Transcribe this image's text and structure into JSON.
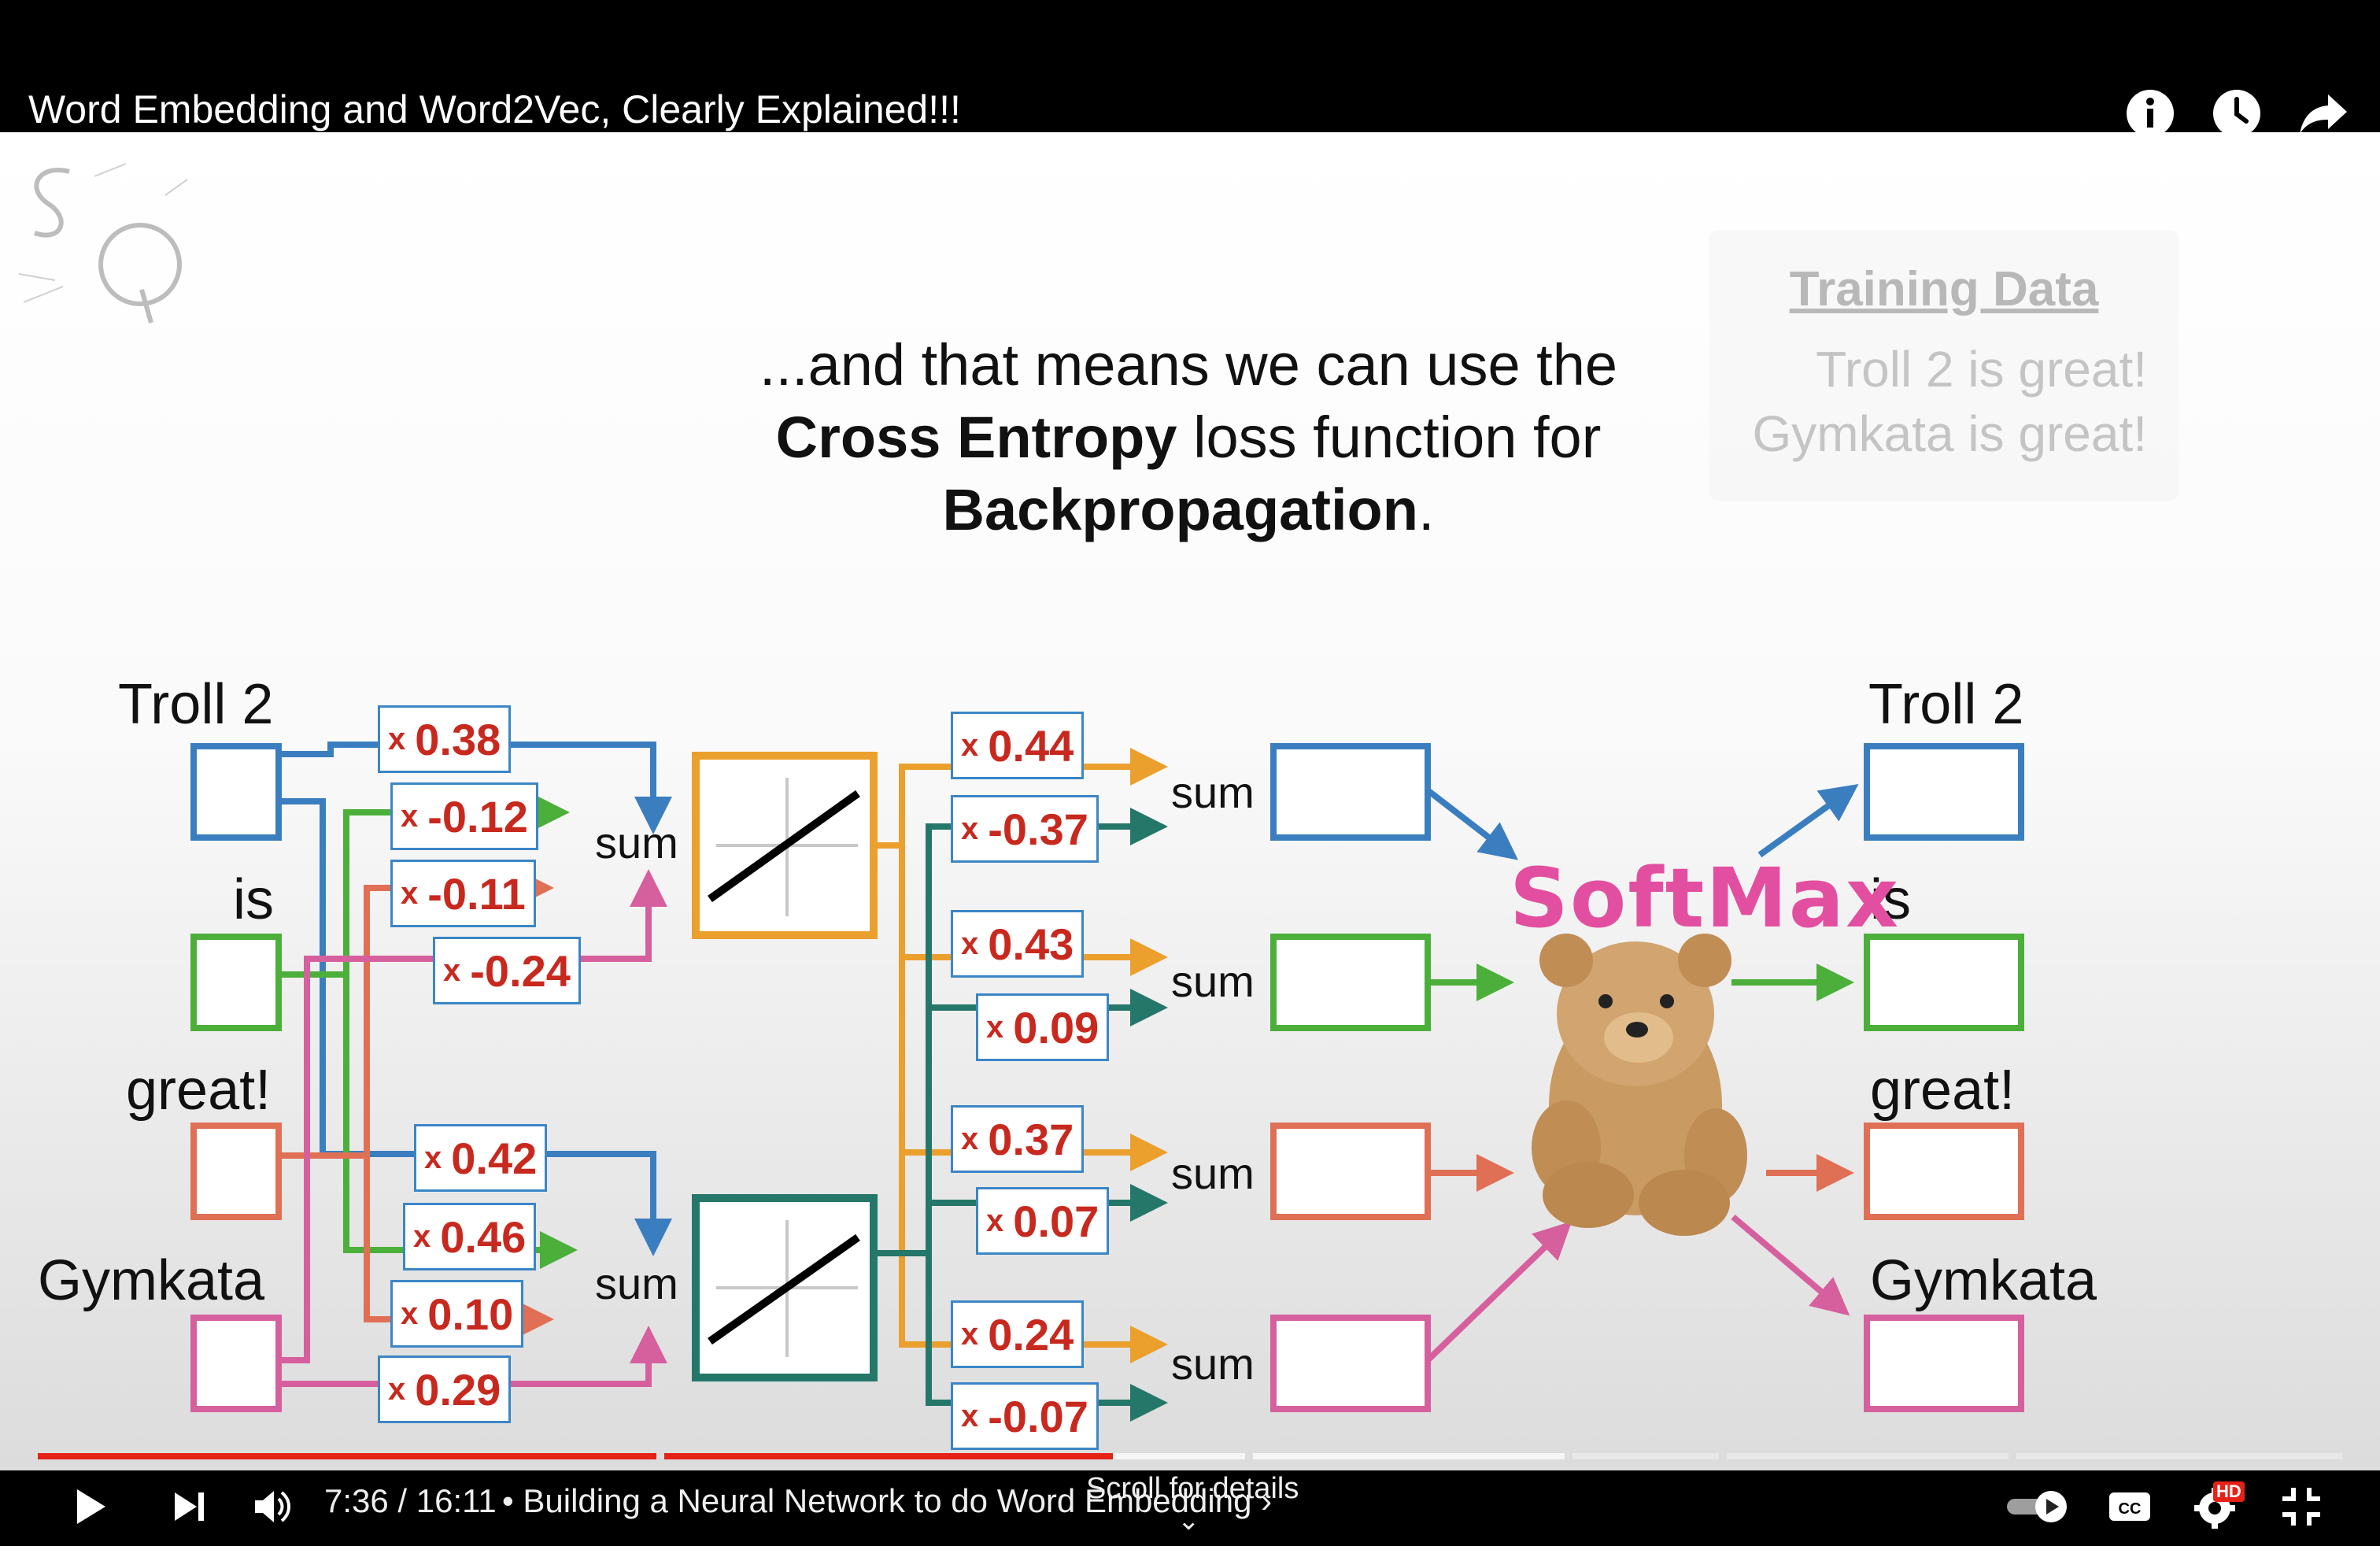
{
  "header": {
    "title": "Word Embedding and Word2Vec, Clearly Explained!!!",
    "icons": [
      "info-icon",
      "clock-icon",
      "share-icon"
    ]
  },
  "slide": {
    "headline": {
      "line1": "...and that means we can use the",
      "bold1": "Cross Entropy",
      "rest2": " loss function for",
      "bold2": "Backpropagation",
      "end": "."
    },
    "training_data": {
      "title": "Training Data",
      "lines": [
        "Troll 2 is great!",
        "Gymkata is great!"
      ]
    },
    "inputs": [
      "Troll 2",
      "is",
      "great!",
      "Gymkata"
    ],
    "outputs": [
      "Troll 2",
      "is",
      "great!",
      "Gymkata"
    ],
    "input_weights_top": [
      "0.38",
      "-0.12",
      "-0.11",
      "-0.24"
    ],
    "input_weights_bottom": [
      "0.42",
      "0.46",
      "0.10",
      "0.29"
    ],
    "hidden_weights": [
      "0.44",
      "-0.37",
      "0.43",
      "0.09",
      "0.37",
      "0.07",
      "0.24",
      "-0.07"
    ],
    "weight_prefix": "x",
    "sum_label": "sum",
    "softmax_label": "SoftMax",
    "colors": {
      "blue": "#3b7ec0",
      "green": "#4caf3a",
      "red": "#e07055",
      "pink": "#d6609e",
      "orange": "#eba02e",
      "teal": "#25776a",
      "weight_text": "#c8291f",
      "softmax": "#e34fa0"
    }
  },
  "player": {
    "time": "7:36 / 16:11",
    "chapter": "• Building a Neural Network to do Word Embedding ›",
    "scroll_hint": "Scroll for details",
    "progress_fraction": 0.47,
    "controls_left": [
      "play-icon",
      "next-icon",
      "volume-icon"
    ],
    "controls_right": [
      "autoplay-toggle",
      "captions-icon",
      "settings-icon",
      "exit-fullscreen-icon"
    ],
    "settings_badge": "HD"
  }
}
